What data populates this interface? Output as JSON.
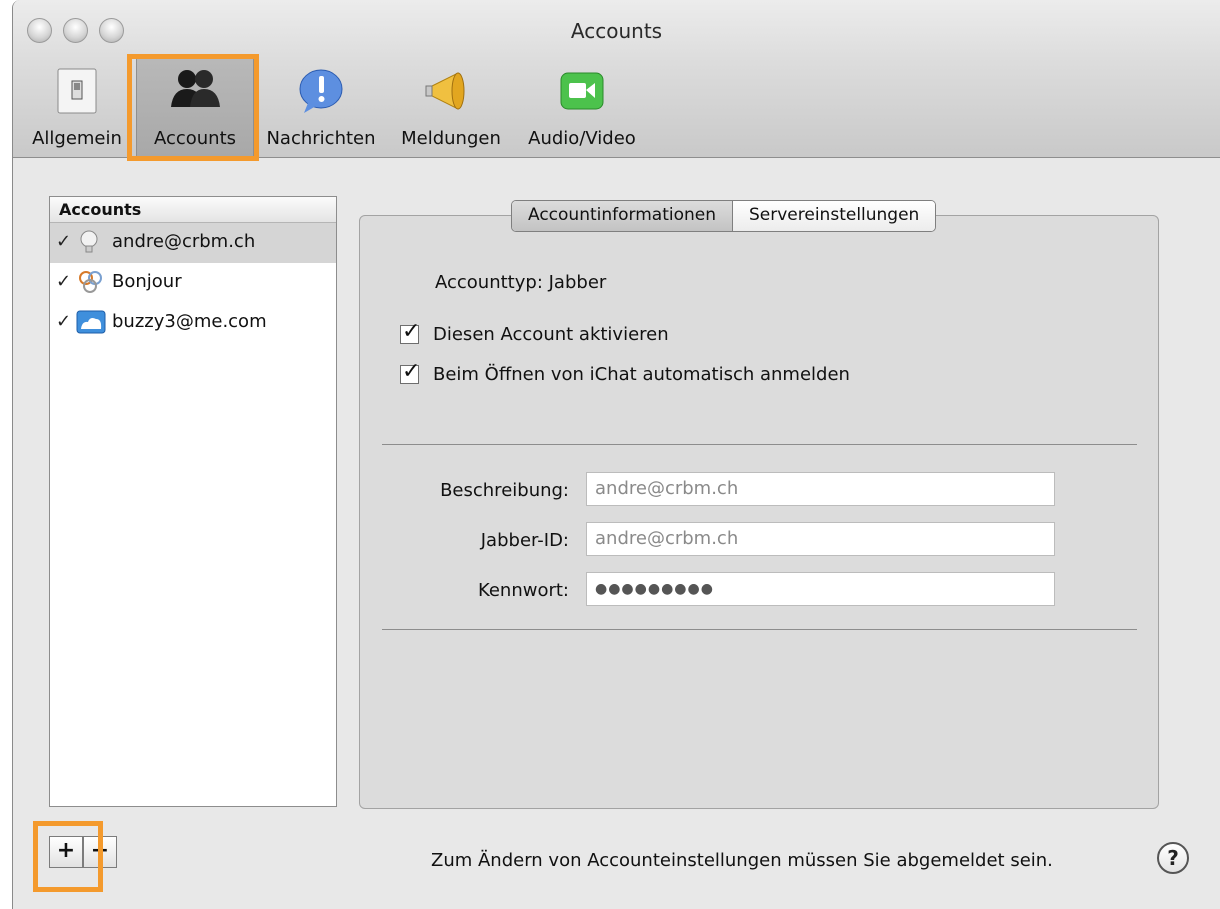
{
  "window": {
    "title": "Accounts"
  },
  "toolbar": {
    "items": [
      {
        "label": "Allgemein",
        "icon": "switch-icon"
      },
      {
        "label": "Accounts",
        "icon": "people-icon",
        "selected": true
      },
      {
        "label": "Nachrichten",
        "icon": "exclamation-bubble-icon"
      },
      {
        "label": "Meldungen",
        "icon": "megaphone-icon"
      },
      {
        "label": "Audio/Video",
        "icon": "video-camera-icon"
      }
    ]
  },
  "accounts": {
    "header": "Accounts",
    "items": [
      {
        "check": "✓",
        "icon": "lightbulb-icon",
        "name": "andre@crbm.ch",
        "selected": true
      },
      {
        "check": "✓",
        "icon": "bonjour-icon",
        "name": "Bonjour"
      },
      {
        "check": "✓",
        "icon": "mobileme-cloud-icon",
        "name": "buzzy3@me.com"
      }
    ],
    "add_label": "+",
    "remove_label": "−"
  },
  "tabs": [
    "Accountinformationen",
    "Servereinstellungen"
  ],
  "account_info": {
    "type_label": "Accounttyp:",
    "type_value": "Jabber",
    "enable_label": "Diesen Account aktivieren",
    "enable_checked": true,
    "autologin_label": "Beim Öffnen von iChat automatisch anmelden",
    "autologin_checked": true
  },
  "fields": {
    "description_label": "Beschreibung:",
    "description_value": "andre@crbm.ch",
    "jabber_label": "Jabber-ID:",
    "jabber_value": "andre@crbm.ch",
    "password_label": "Kennwort:",
    "password_value": "●●●●●●●●●"
  },
  "footer": {
    "note": "Zum Ändern von Accounteinstellungen müssen Sie abgemeldet sein.",
    "help_label": "?"
  },
  "colors": {
    "highlight": "#f49a2d",
    "window_bg": "#e8e8e8"
  }
}
